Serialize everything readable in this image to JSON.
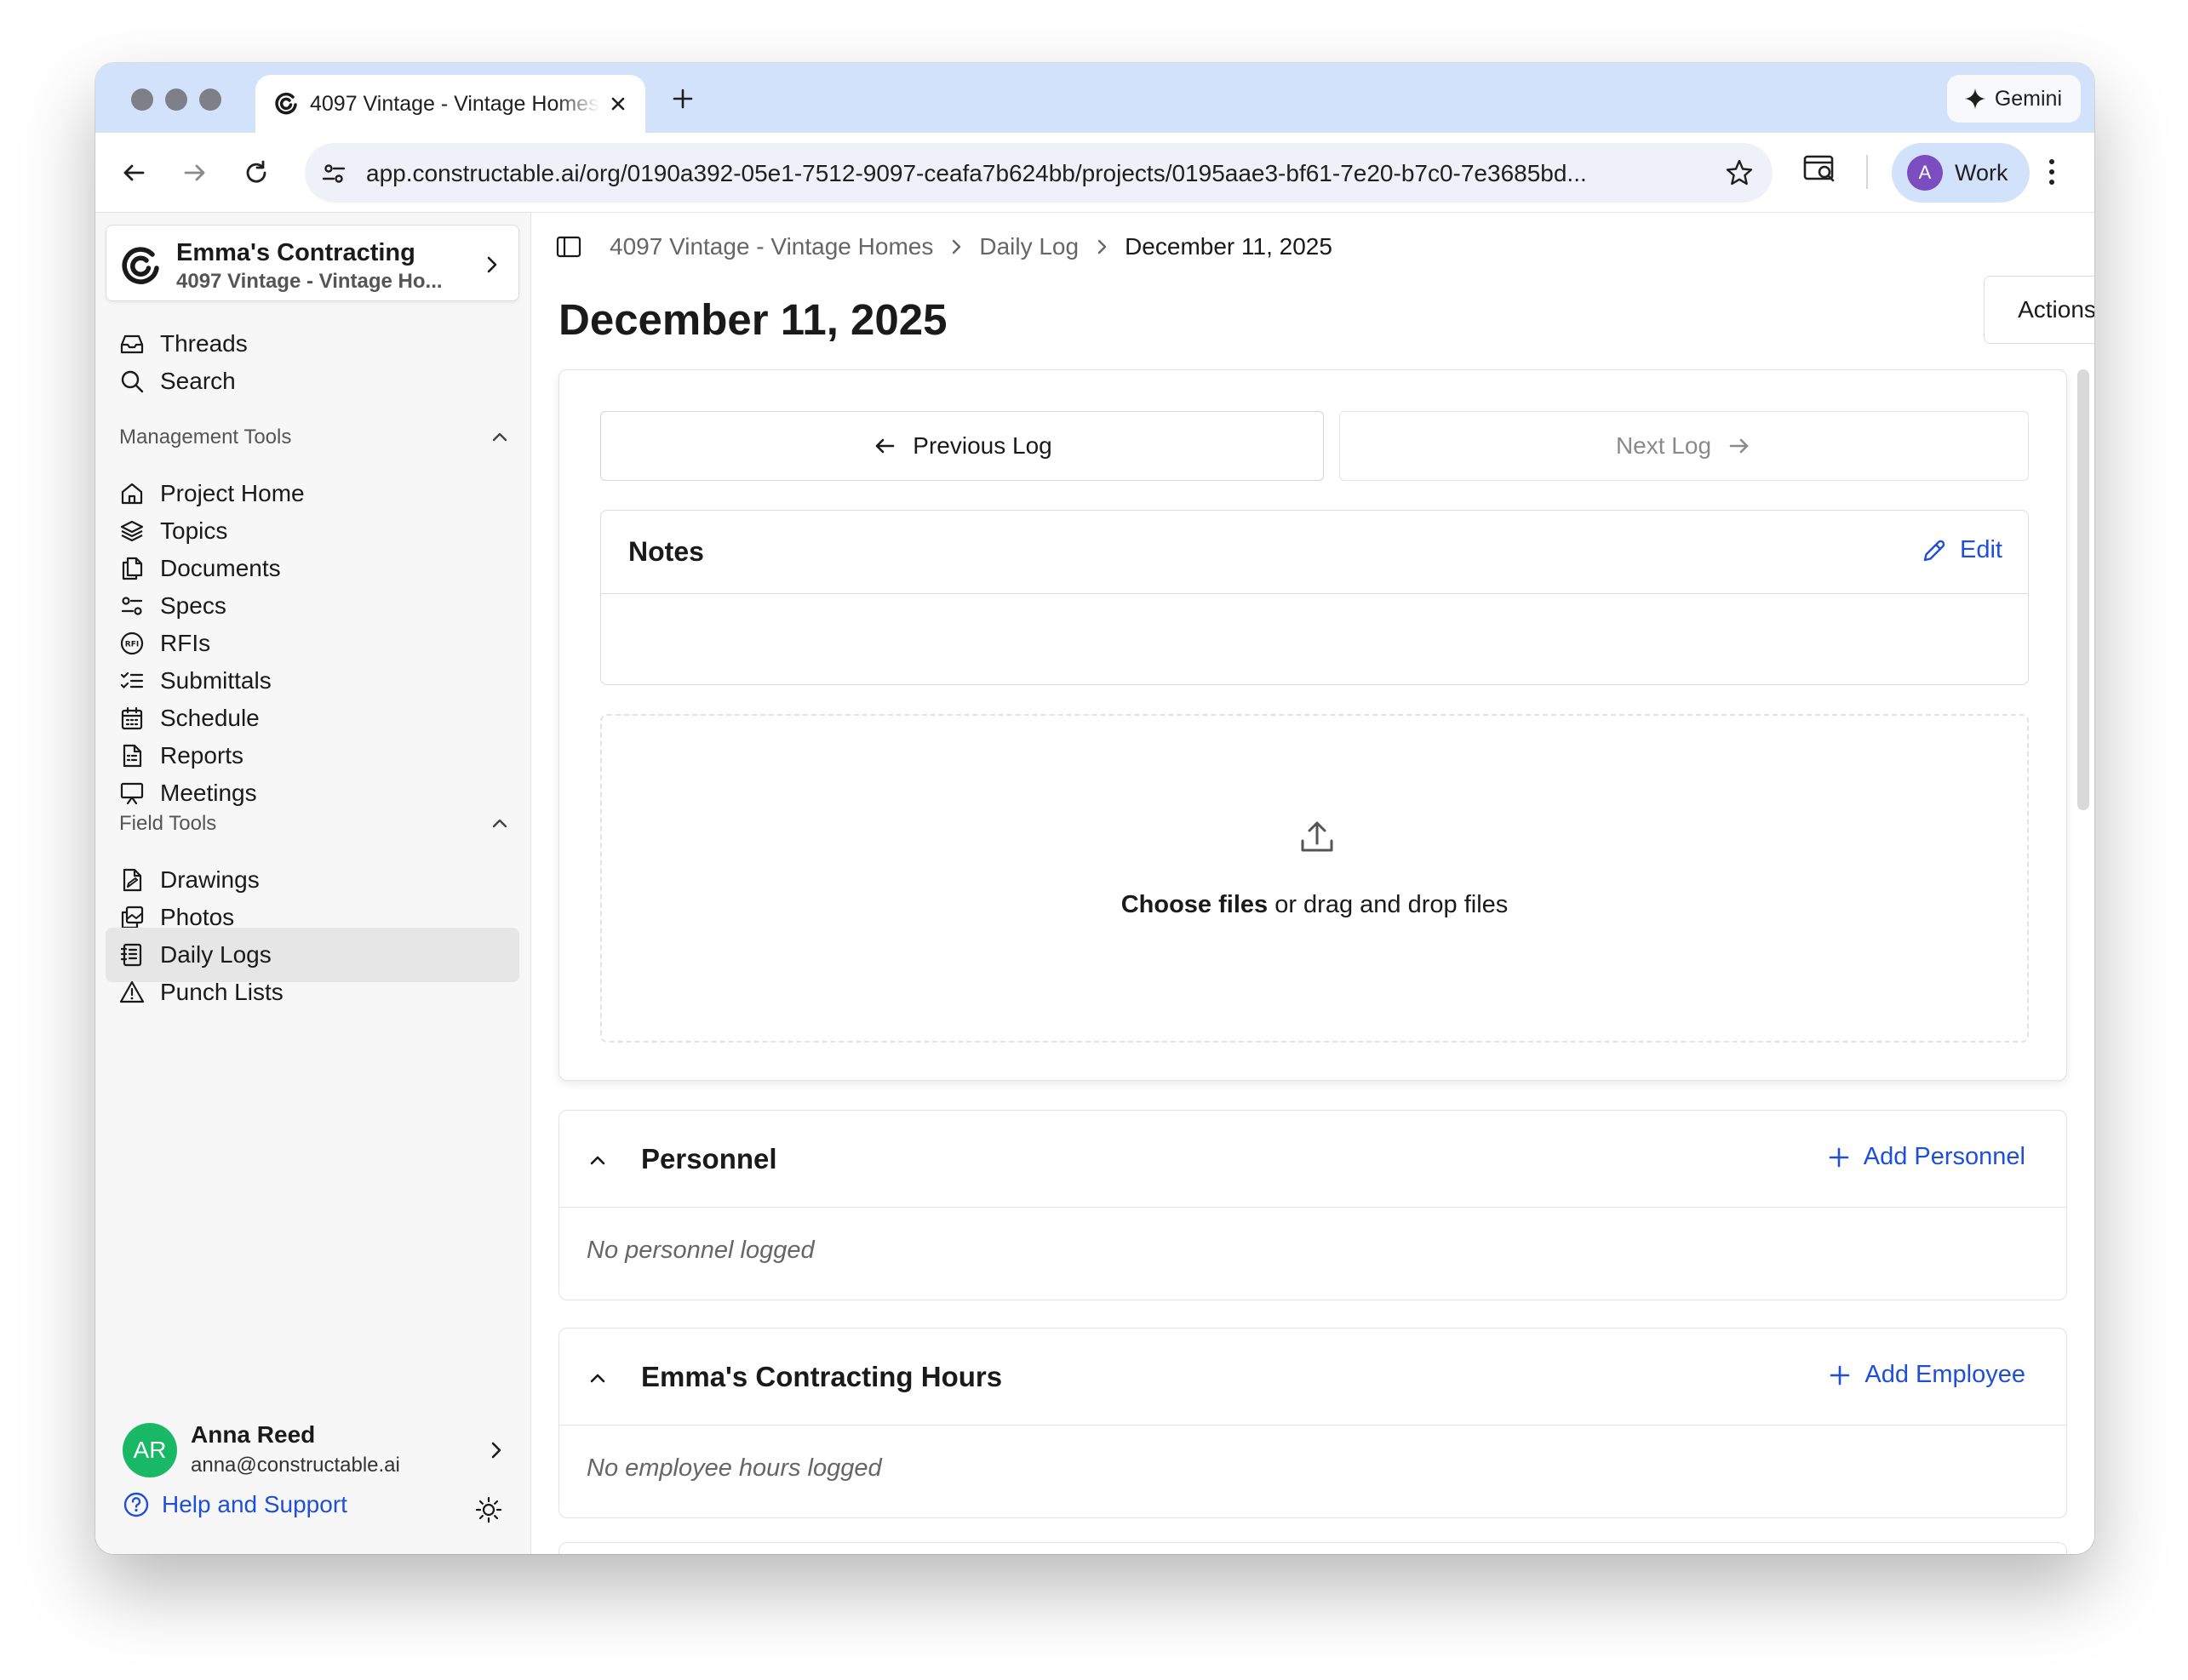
{
  "browser": {
    "tab_title": "4097 Vintage - Vintage Homes",
    "new_tab_symbol": "+",
    "gemini_label": "Gemini",
    "url": "app.constructable.ai/org/0190a392-05e1-7512-9097-ceafa7b624bb/projects/0195aae3-bf61-7e20-b7c0-7e3685bd...",
    "profile_initial": "A",
    "profile_label": "Work"
  },
  "sidebar": {
    "org_name": "Emma's Contracting",
    "project_name": "4097 Vintage - Vintage Ho...",
    "top_items": [
      {
        "label": "Threads",
        "icon": "inbox-icon"
      },
      {
        "label": "Search",
        "icon": "search-icon"
      }
    ],
    "management_header": "Management Tools",
    "management_items": [
      {
        "label": "Project Home",
        "icon": "home-icon"
      },
      {
        "label": "Topics",
        "icon": "layers-icon"
      },
      {
        "label": "Documents",
        "icon": "documents-icon"
      },
      {
        "label": "Specs",
        "icon": "specs-icon"
      },
      {
        "label": "RFIs",
        "icon": "rfi-icon"
      },
      {
        "label": "Submittals",
        "icon": "checklist-icon"
      },
      {
        "label": "Schedule",
        "icon": "calendar-icon"
      },
      {
        "label": "Reports",
        "icon": "report-icon"
      },
      {
        "label": "Meetings",
        "icon": "presentation-icon"
      }
    ],
    "field_header": "Field Tools",
    "field_items": [
      {
        "label": "Drawings",
        "icon": "drawing-icon"
      },
      {
        "label": "Photos",
        "icon": "photos-icon"
      },
      {
        "label": "Daily Logs",
        "icon": "daily-log-icon",
        "active": true
      },
      {
        "label": "Punch Lists",
        "icon": "warning-icon"
      }
    ],
    "user": {
      "initials": "AR",
      "name": "Anna Reed",
      "email": "anna@constructable.ai"
    },
    "help_label": "Help and Support"
  },
  "main": {
    "breadcrumbs": [
      "4097 Vintage - Vintage Homes",
      "Daily Log",
      "December 11, 2025"
    ],
    "title": "December 11, 2025",
    "actions_label": "Actions",
    "previous_label": "Previous Log",
    "next_label": "Next Log",
    "notes_title": "Notes",
    "edit_label": "Edit",
    "upload_choose": "Choose files",
    "upload_rest": " or drag and drop files",
    "personnel": {
      "title": "Personnel",
      "add_label": "Add Personnel",
      "empty": "No personnel logged"
    },
    "hours": {
      "title": "Emma's Contracting Hours",
      "add_label": "Add Employee",
      "empty": "No employee hours logged"
    }
  },
  "colors": {
    "link_blue": "#1f4fd8",
    "tabstrip": "#d3e2fb",
    "avatar_green": "#19b866",
    "profile_purple": "#7c4dbe"
  }
}
